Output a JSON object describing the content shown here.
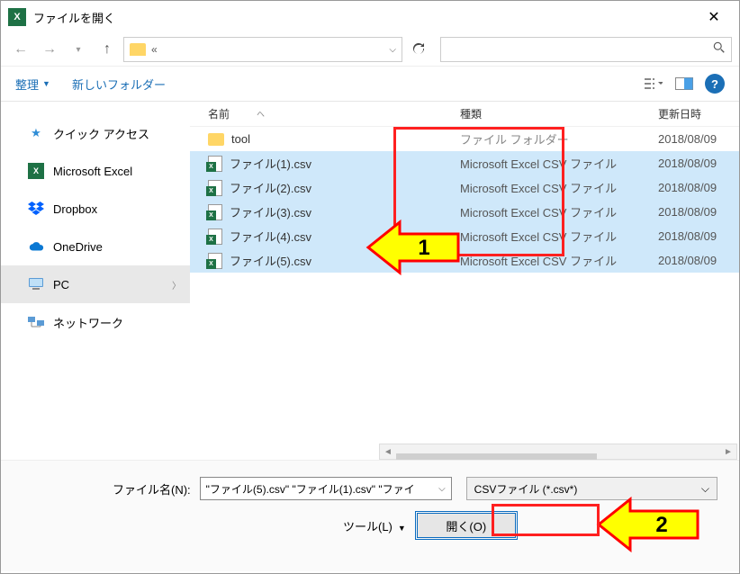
{
  "titlebar": {
    "title": "ファイルを開く"
  },
  "navbar": {
    "address_text": "«",
    "refresh_icon": "refresh"
  },
  "toolbar": {
    "organize": "整理",
    "new_folder": "新しいフォルダー"
  },
  "sidebar": {
    "items": [
      {
        "label": "クイック アクセス",
        "icon": "star"
      },
      {
        "label": "Microsoft Excel",
        "icon": "excel"
      },
      {
        "label": "Dropbox",
        "icon": "dropbox"
      },
      {
        "label": "OneDrive",
        "icon": "onedrive"
      },
      {
        "label": "PC",
        "icon": "pc",
        "selected": true,
        "expandable": true
      },
      {
        "label": "ネットワーク",
        "icon": "net"
      }
    ]
  },
  "columns": {
    "name": "名前",
    "type": "種類",
    "date": "更新日時"
  },
  "files": [
    {
      "name": "tool",
      "type": "ファイル フォルダー",
      "date": "2018/08/09",
      "icon": "folder",
      "selected": false
    },
    {
      "name": "ファイル(1).csv",
      "type": "Microsoft Excel CSV ファイル",
      "date": "2018/08/09",
      "icon": "csv",
      "selected": true
    },
    {
      "name": "ファイル(2).csv",
      "type": "Microsoft Excel CSV ファイル",
      "date": "2018/08/09",
      "icon": "csv",
      "selected": true
    },
    {
      "name": "ファイル(3).csv",
      "type": "Microsoft Excel CSV ファイル",
      "date": "2018/08/09",
      "icon": "csv",
      "selected": true
    },
    {
      "name": "ファイル(4).csv",
      "type": "Microsoft Excel CSV ファイル",
      "date": "2018/08/09",
      "icon": "csv",
      "selected": true
    },
    {
      "name": "ファイル(5).csv",
      "type": "Microsoft Excel CSV ファイル",
      "date": "2018/08/09",
      "icon": "csv",
      "selected": true
    }
  ],
  "bottom": {
    "filename_label": "ファイル名(N):",
    "filename_value": "\"ファイル(5).csv\" \"ファイル(1).csv\" \"ファイ",
    "type_filter": "CSVファイル (*.csv*)",
    "tools_label": "ツール(L)",
    "open_button": "開く(O)"
  },
  "annotations": {
    "num1": "1",
    "num2": "2"
  }
}
